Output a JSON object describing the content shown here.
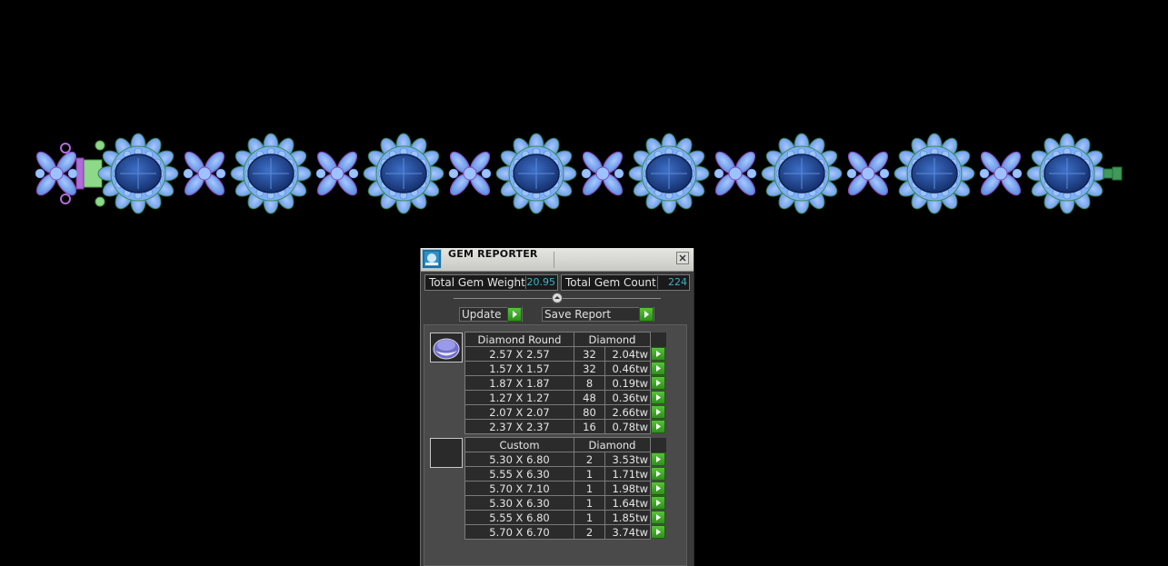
{
  "panel": {
    "title": "GEM REPORTER",
    "total_weight_label": "Total Gem Weight",
    "total_weight_value": "20.95",
    "total_count_label": "Total Gem Count",
    "total_count_value": "224",
    "update_label": "Update",
    "save_report_label": "Save Report"
  },
  "groups": [
    {
      "shape": "Diamond Round",
      "material": "Diamond",
      "thumb_icon": "round-diamond-icon",
      "rows": [
        {
          "size": "2.57 X 2.57",
          "count": "32",
          "weight": "2.04tw"
        },
        {
          "size": "1.57 X 1.57",
          "count": "32",
          "weight": "0.46tw"
        },
        {
          "size": "1.87 X 1.87",
          "count": "8",
          "weight": "0.19tw"
        },
        {
          "size": "1.27 X 1.27",
          "count": "48",
          "weight": "0.36tw"
        },
        {
          "size": "2.07 X 2.07",
          "count": "80",
          "weight": "2.66tw"
        },
        {
          "size": "2.37 X 2.37",
          "count": "16",
          "weight": "0.78tw"
        }
      ]
    },
    {
      "shape": "Custom",
      "material": "Diamond",
      "thumb_icon": "custom-gem-icon",
      "rows": [
        {
          "size": "5.30 X 6.80",
          "count": "2",
          "weight": "3.53tw"
        },
        {
          "size": "5.55 X 6.30",
          "count": "1",
          "weight": "1.71tw"
        },
        {
          "size": "5.70 X 7.10",
          "count": "1",
          "weight": "1.98tw"
        },
        {
          "size": "5.30 X 6.30",
          "count": "1",
          "weight": "1.64tw"
        },
        {
          "size": "5.55 X 6.80",
          "count": "1",
          "weight": "1.85tw"
        },
        {
          "size": "5.70 X 6.70",
          "count": "2",
          "weight": "3.74tw"
        }
      ]
    }
  ],
  "colors": {
    "background": "#000000",
    "gem_blue": "#6fa3ef",
    "sapphire": "#1c3f8c",
    "prong_green": "#3f9a5a",
    "accent_purple": "#a35bd0",
    "value_cyan": "#3fb0c8",
    "arrow_green": "#3fa82a"
  }
}
